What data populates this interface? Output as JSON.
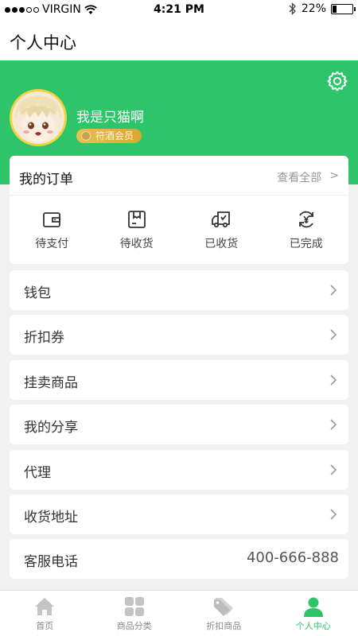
{
  "status_bar": {
    "carrier": "VIRGIN",
    "time": "4:21 PM",
    "battery": "22%",
    "battery_level": 0.22
  },
  "nav": {
    "title": "个人中心"
  },
  "profile": {
    "username": "我是只猫啊",
    "member_level": "符酒会员"
  },
  "orders": {
    "title": "我的订单",
    "view_all": "查看全部",
    "view_all_arrow": ">",
    "items": [
      {
        "label": "待支付",
        "icon": "wallet-icon"
      },
      {
        "label": "待收货",
        "icon": "package-icon"
      },
      {
        "label": "已收货",
        "icon": "truck-icon"
      },
      {
        "label": "已完成",
        "icon": "yen-refresh-icon"
      }
    ]
  },
  "menu": [
    {
      "label": "钱包"
    },
    {
      "label": "折扣券"
    },
    {
      "label": "挂卖商品"
    },
    {
      "label": "我的分享"
    },
    {
      "label": "代理"
    },
    {
      "label": "收货地址"
    },
    {
      "label": "客服电话",
      "value": "400-666-888"
    }
  ],
  "tabs": [
    {
      "label": "首页",
      "icon": "home-icon",
      "active": false
    },
    {
      "label": "商品分类",
      "icon": "category-grid-icon",
      "active": false
    },
    {
      "label": "折扣商品",
      "icon": "tags-icon",
      "active": false
    },
    {
      "label": "个人中心",
      "icon": "person-icon",
      "active": true
    }
  ],
  "colors": {
    "brand_green": "#2ec46a",
    "badge_gold": "#e0b440",
    "inactive_tab": "#c4c4c4"
  }
}
